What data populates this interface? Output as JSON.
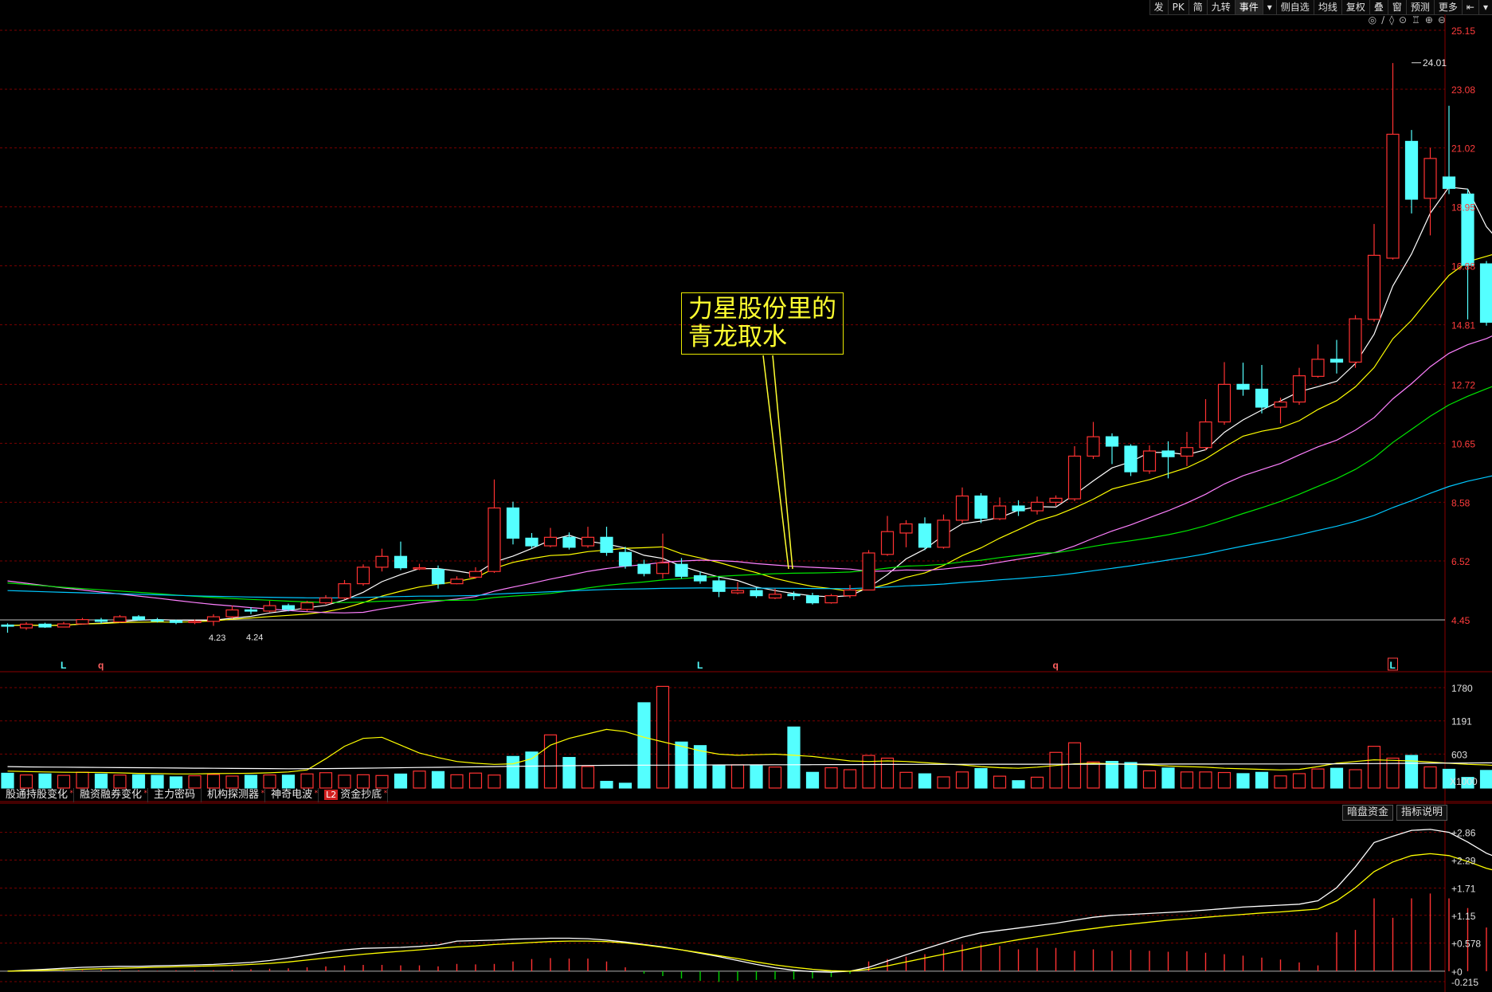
{
  "toolbar": {
    "items": [
      "发",
      "PK",
      "简",
      "九转",
      "事件",
      "▾",
      "侧自选",
      "均线",
      "复权",
      "叠",
      "窗",
      "预测",
      "更多",
      "⇤",
      "▾"
    ]
  },
  "tool_icons": [
    "◎",
    "∕",
    "◊",
    "⊙",
    "♖",
    "⊕",
    "⊖"
  ],
  "annotation": {
    "line1": "力星股份里的",
    "line2": "青龙取水"
  },
  "tabs": [
    {
      "label": "股通持股变化",
      "star": "*"
    },
    {
      "label": "融资融券变化",
      "star": "*"
    },
    {
      "label": "主力密码",
      "star": ""
    },
    {
      "label": "机构探测器",
      "star": "*"
    },
    {
      "label": "神奇电波",
      "star": "*"
    },
    {
      "label": "资金抄底",
      "star": "*",
      "badge": "L2"
    }
  ],
  "indicator_buttons": [
    "暗盘资金",
    "指标说明"
  ],
  "colors": {
    "up": "#ff3232",
    "down": "#54ffff",
    "ma5": "#ffffff",
    "ma10": "#ffff00",
    "ma20": "#ff80ff",
    "ma30": "#00e600",
    "ma60": "#00c8ff",
    "grid": "#7a0000",
    "axis_text": "#ff3c3c",
    "annotation": "#ffff30"
  },
  "chart_data": {
    "type": "candlestick",
    "price_axis": {
      "ticks": [
        25.15,
        23.08,
        21.02,
        18.95,
        16.88,
        14.81,
        12.72,
        10.65,
        8.58,
        6.52,
        4.45
      ],
      "labels": [
        "25.15",
        "23.08",
        "21.02",
        "18.95",
        "16.88",
        "14.81",
        "12.72",
        "10.65",
        "8.58",
        "6.52",
        "4.45"
      ],
      "range": [
        4.45,
        25.15
      ]
    },
    "price_annotations": [
      {
        "text": "24.01",
        "at": 75,
        "value": 24.01
      },
      {
        "text": "4.23",
        "at": 11,
        "value": 4.23
      },
      {
        "text": "4.24",
        "at": 13,
        "value": 4.24
      }
    ],
    "markers": [
      {
        "text": "L",
        "at": 3
      },
      {
        "text": "q",
        "at": 5
      },
      {
        "text": "L",
        "at": 37
      },
      {
        "text": "q",
        "at": 56
      },
      {
        "text": "L",
        "at": 74,
        "boxed": true
      }
    ],
    "candles": [
      [
        4.27,
        4.25,
        4.33,
        4.0
      ],
      [
        4.17,
        4.3,
        4.37,
        4.1
      ],
      [
        4.3,
        4.2,
        4.35,
        4.17
      ],
      [
        4.2,
        4.31,
        4.38,
        4.2
      ],
      [
        4.31,
        4.46,
        4.52,
        4.28
      ],
      [
        4.45,
        4.4,
        4.52,
        4.32
      ],
      [
        4.38,
        4.56,
        4.62,
        4.35
      ],
      [
        4.56,
        4.46,
        4.62,
        4.42
      ],
      [
        4.45,
        4.42,
        4.52,
        4.36
      ],
      [
        4.42,
        4.36,
        4.46,
        4.3
      ],
      [
        4.36,
        4.4,
        4.46,
        4.3
      ],
      [
        4.4,
        4.56,
        4.65,
        4.24
      ],
      [
        4.56,
        4.8,
        4.95,
        4.5
      ],
      [
        4.8,
        4.76,
        4.9,
        4.65
      ],
      [
        4.76,
        4.95,
        5.12,
        4.72
      ],
      [
        4.95,
        4.82,
        5.02,
        4.75
      ],
      [
        4.82,
        5.05,
        5.12,
        4.76
      ],
      [
        5.05,
        5.22,
        5.32,
        5.0
      ],
      [
        5.22,
        5.72,
        5.85,
        5.18
      ],
      [
        5.72,
        6.3,
        6.4,
        5.65
      ],
      [
        6.3,
        6.68,
        6.95,
        6.15
      ],
      [
        6.68,
        6.28,
        7.2,
        6.2
      ],
      [
        6.28,
        6.28,
        6.42,
        6.2
      ],
      [
        6.22,
        5.72,
        6.36,
        5.55
      ],
      [
        5.72,
        5.88,
        5.98,
        5.7
      ],
      [
        5.95,
        6.15,
        6.3,
        5.9
      ],
      [
        6.15,
        8.38,
        9.38,
        6.1
      ],
      [
        8.38,
        7.32,
        8.6,
        7.1
      ],
      [
        7.32,
        7.05,
        7.5,
        6.95
      ],
      [
        7.05,
        7.35,
        7.68,
        7.0
      ],
      [
        7.35,
        7.0,
        7.52,
        6.92
      ],
      [
        7.05,
        7.35,
        7.72,
        6.98
      ],
      [
        7.35,
        6.82,
        7.72,
        6.7
      ],
      [
        6.82,
        6.35,
        7.02,
        6.25
      ],
      [
        6.4,
        6.08,
        6.56,
        5.98
      ],
      [
        6.08,
        6.45,
        7.48,
        5.9
      ],
      [
        6.4,
        5.98,
        6.62,
        5.9
      ],
      [
        6.0,
        5.82,
        6.15,
        5.72
      ],
      [
        5.82,
        5.45,
        5.98,
        5.25
      ],
      [
        5.4,
        5.48,
        5.78,
        5.35
      ],
      [
        5.48,
        5.3,
        5.6,
        5.22
      ],
      [
        5.22,
        5.35,
        5.55,
        5.18
      ],
      [
        5.35,
        5.3,
        5.45,
        5.15
      ],
      [
        5.3,
        5.05,
        5.4,
        4.99
      ],
      [
        5.05,
        5.3,
        5.36,
        5.02
      ],
      [
        5.3,
        5.5,
        5.68,
        5.22
      ],
      [
        5.5,
        6.8,
        6.9,
        5.5
      ],
      [
        6.75,
        7.55,
        8.1,
        6.7
      ],
      [
        7.5,
        7.82,
        7.95,
        7.0
      ],
      [
        7.82,
        7.0,
        8.05,
        6.9
      ],
      [
        7.0,
        7.95,
        8.15,
        6.95
      ],
      [
        7.95,
        8.8,
        9.1,
        7.85
      ],
      [
        8.8,
        8.02,
        8.9,
        7.85
      ],
      [
        8.0,
        8.45,
        8.75,
        7.95
      ],
      [
        8.45,
        8.28,
        8.65,
        8.1
      ],
      [
        8.28,
        8.58,
        8.78,
        8.15
      ],
      [
        8.58,
        8.72,
        8.82,
        8.45
      ],
      [
        8.7,
        10.2,
        10.55,
        8.62
      ],
      [
        10.2,
        10.88,
        11.4,
        10.1
      ],
      [
        10.88,
        10.55,
        11.0,
        9.92
      ],
      [
        10.55,
        9.65,
        10.62,
        9.5
      ],
      [
        9.68,
        10.38,
        10.58,
        9.58
      ],
      [
        10.38,
        10.18,
        10.72,
        9.42
      ],
      [
        10.2,
        10.5,
        11.05,
        9.85
      ],
      [
        10.5,
        11.4,
        12.2,
        10.4
      ],
      [
        11.4,
        12.72,
        13.5,
        11.3
      ],
      [
        12.72,
        12.55,
        13.48,
        12.32
      ],
      [
        12.55,
        11.92,
        13.4,
        11.7
      ],
      [
        11.92,
        12.1,
        12.25,
        11.35
      ],
      [
        12.1,
        13.02,
        13.3,
        12.0
      ],
      [
        13.0,
        13.6,
        14.12,
        12.95
      ],
      [
        13.6,
        13.5,
        14.28,
        13.1
      ],
      [
        13.5,
        15.02,
        15.15,
        13.3
      ],
      [
        15.0,
        17.25,
        18.35,
        14.92
      ],
      [
        17.15,
        21.5,
        24.0,
        17.1
      ],
      [
        21.25,
        19.22,
        21.65,
        18.72
      ],
      [
        19.25,
        20.65,
        21.02,
        17.95
      ],
      [
        20.0,
        19.6,
        22.5,
        19.4
      ],
      [
        19.4,
        16.9,
        19.58,
        15.0
      ],
      [
        16.95,
        14.9,
        17.05,
        14.78
      ],
      [
        14.8,
        15.5,
        15.6,
        14.8
      ]
    ],
    "volume": {
      "ticks": [
        1780,
        1191,
        603
      ],
      "labels": [
        "1780",
        "1191",
        "603"
      ],
      "unit": "X1000",
      "values": [
        262,
        232,
        250,
        225,
        280,
        248,
        230,
        235,
        225,
        198,
        218,
        240,
        212,
        225,
        232,
        228,
        250,
        272,
        228,
        235,
        222,
        248,
        300,
        292,
        235,
        265,
        230,
        560,
        638,
        942,
        542,
        382,
        118,
        85,
        1512,
        1802,
        815,
        752,
        395,
        412,
        395,
        372,
        1082,
        278,
        360,
        325,
        578,
        530,
        278,
        252,
        198,
        285,
        345,
        210,
        130,
        192,
        632,
        802,
        462,
        472,
        452,
        305,
        355,
        285,
        285,
        275,
        255,
        278,
        215,
        255,
        338,
        350,
        325,
        740,
        530,
        578,
        375,
        332,
        188,
        312,
        695
      ],
      "ma_a": [
        300,
        292,
        285,
        280,
        278,
        275,
        268,
        260,
        255,
        250,
        250,
        255,
        258,
        262,
        270,
        285,
        320,
        520,
        740,
        880,
        900,
        760,
        620,
        540,
        470,
        440,
        420,
        430,
        520,
        760,
        880,
        960,
        1040,
        1000,
        900,
        820,
        740,
        660,
        600,
        580,
        590,
        600,
        580,
        560,
        520,
        480,
        470,
        480,
        470,
        450,
        430,
        410,
        380,
        360,
        350,
        370,
        400,
        430,
        440,
        430,
        420,
        410,
        390,
        380,
        370,
        350,
        340,
        330,
        320,
        330,
        380,
        440,
        470,
        500,
        490,
        480,
        460,
        440,
        420,
        410,
        390
      ],
      "ma_b": [
        380,
        375,
        372,
        370,
        368,
        365,
        362,
        360,
        358,
        355,
        352,
        350,
        348,
        346,
        344,
        342,
        343,
        345,
        348,
        352,
        356,
        360,
        364,
        368,
        372,
        376,
        380,
        384,
        388,
        392,
        396,
        400,
        402,
        404,
        405,
        406,
        407,
        408,
        409,
        410,
        411,
        412,
        413,
        414,
        415,
        416,
        417,
        418,
        419,
        420,
        420,
        421,
        421,
        422,
        422,
        422,
        423,
        423,
        423,
        424,
        424,
        424,
        425,
        425,
        425,
        426,
        426,
        426,
        427,
        427,
        428,
        430,
        432,
        434,
        436,
        438,
        440,
        442,
        444,
        446,
        448
      ]
    },
    "indicator": {
      "ticks": [
        2.86,
        2.29,
        1.71,
        1.15,
        0.578,
        0,
        -0.215
      ],
      "labels": [
        "+2.86",
        "+2.29",
        "+1.71",
        "+1.15",
        "+0.578",
        "+0",
        "-0.215"
      ],
      "range": [
        -0.215,
        3.05
      ],
      "white": [
        0.0,
        0.02,
        0.04,
        0.06,
        0.08,
        0.09,
        0.1,
        0.1,
        0.11,
        0.12,
        0.13,
        0.14,
        0.16,
        0.18,
        0.22,
        0.27,
        0.33,
        0.39,
        0.44,
        0.47,
        0.48,
        0.49,
        0.51,
        0.54,
        0.62,
        0.63,
        0.64,
        0.66,
        0.67,
        0.68,
        0.68,
        0.67,
        0.64,
        0.6,
        0.55,
        0.5,
        0.44,
        0.37,
        0.3,
        0.22,
        0.14,
        0.07,
        0.02,
        -0.01,
        -0.02,
        0.0,
        0.08,
        0.21,
        0.34,
        0.46,
        0.58,
        0.7,
        0.79,
        0.84,
        0.89,
        0.94,
        0.99,
        1.05,
        1.11,
        1.15,
        1.17,
        1.19,
        1.21,
        1.23,
        1.26,
        1.29,
        1.32,
        1.34,
        1.36,
        1.38,
        1.45,
        1.72,
        2.15,
        2.65,
        2.78,
        2.9,
        2.92,
        2.86,
        2.66,
        2.43,
        2.28
      ],
      "yellow": [
        0.0,
        0.01,
        0.02,
        0.03,
        0.04,
        0.05,
        0.06,
        0.07,
        0.08,
        0.09,
        0.1,
        0.11,
        0.12,
        0.14,
        0.16,
        0.19,
        0.23,
        0.27,
        0.31,
        0.35,
        0.38,
        0.41,
        0.44,
        0.47,
        0.5,
        0.52,
        0.55,
        0.57,
        0.59,
        0.61,
        0.62,
        0.62,
        0.61,
        0.58,
        0.54,
        0.49,
        0.44,
        0.38,
        0.32,
        0.26,
        0.19,
        0.13,
        0.08,
        0.04,
        0.01,
        0.0,
        0.04,
        0.11,
        0.19,
        0.27,
        0.35,
        0.43,
        0.51,
        0.58,
        0.65,
        0.71,
        0.77,
        0.83,
        0.88,
        0.93,
        0.97,
        1.01,
        1.05,
        1.08,
        1.11,
        1.14,
        1.17,
        1.2,
        1.22,
        1.25,
        1.28,
        1.45,
        1.72,
        2.05,
        2.25,
        2.38,
        2.42,
        2.38,
        2.26,
        2.12,
        2.02
      ],
      "bars": [
        0.0,
        0.0,
        0.0,
        0.02,
        0.02,
        0.03,
        0.02,
        0.02,
        0.01,
        0.02,
        0.02,
        0.02,
        0.03,
        0.04,
        0.05,
        0.06,
        0.08,
        0.1,
        0.12,
        0.13,
        0.13,
        0.12,
        0.12,
        0.1,
        0.15,
        0.14,
        0.15,
        0.2,
        0.25,
        0.27,
        0.26,
        0.26,
        0.2,
        0.08,
        -0.05,
        -0.1,
        -0.15,
        -0.2,
        -0.22,
        -0.2,
        -0.18,
        -0.17,
        -0.17,
        -0.15,
        -0.12,
        -0.05,
        0.2,
        0.25,
        0.3,
        0.35,
        0.45,
        0.55,
        0.55,
        0.52,
        0.45,
        0.48,
        0.48,
        0.42,
        0.45,
        0.42,
        0.44,
        0.42,
        0.4,
        0.41,
        0.38,
        0.35,
        0.32,
        0.28,
        0.24,
        0.18,
        0.12,
        0.8,
        0.85,
        1.5,
        1.1,
        1.5,
        1.6,
        1.5,
        1.3,
        0.9,
        0.0
      ]
    }
  }
}
